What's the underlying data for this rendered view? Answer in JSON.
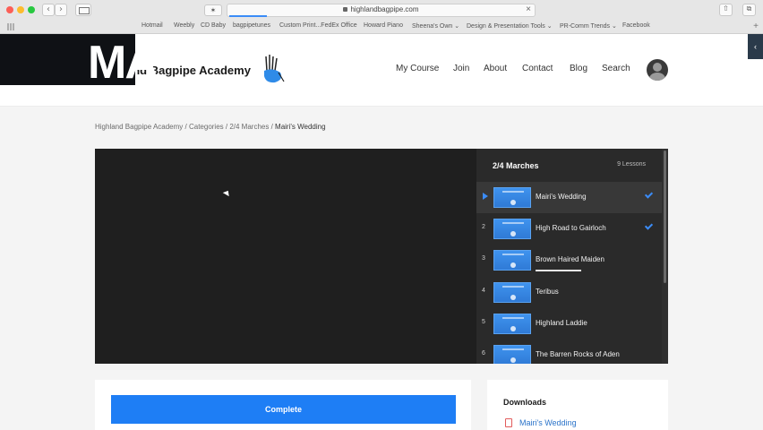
{
  "browser": {
    "url": "highlandbagpipe.com",
    "bookmarks": [
      "Hotmail",
      "Weebly",
      "CD Baby",
      "bagpipetunes",
      "Custom Print...FedEx Office",
      "Howard Piano",
      "Sheena's Own ⌄",
      "Design & Presentation Tools ⌄",
      "PR-Comm Trends ⌄",
      "Facebook"
    ]
  },
  "site": {
    "logo_text": "and Bagpipe Academy",
    "overlay_text": "MA",
    "nav": [
      "My Course",
      "Join",
      "About",
      "Contact",
      "Blog",
      "Search"
    ]
  },
  "breadcrumb": {
    "items": [
      "Highland Bagpipe Academy",
      "Categories",
      "2/4 Marches"
    ],
    "separator": " / ",
    "current": "Mairi's Wedding"
  },
  "playlist": {
    "title": "2/4 Marches",
    "count": "9 Lessons",
    "items": [
      {
        "num": "",
        "label": "Mairi's Wedding",
        "completed": true,
        "active": true
      },
      {
        "num": "2",
        "label": "High Road to Gairloch",
        "completed": true,
        "active": false
      },
      {
        "num": "3",
        "label": "Brown Haired Maiden",
        "completed": false,
        "active": false
      },
      {
        "num": "4",
        "label": "Teribus",
        "completed": false,
        "active": false
      },
      {
        "num": "5",
        "label": "Highland Laddie",
        "completed": false,
        "active": false
      },
      {
        "num": "6",
        "label": "The Barren Rocks of Aden",
        "completed": false,
        "active": false
      }
    ]
  },
  "actions": {
    "complete_label": "Complete"
  },
  "downloads": {
    "title": "Downloads",
    "file": "Mairi's Wedding"
  },
  "colors": {
    "accent": "#1e7ef5",
    "playlist_bg": "#2a2a2a",
    "video_bg": "#1f1f1f"
  }
}
